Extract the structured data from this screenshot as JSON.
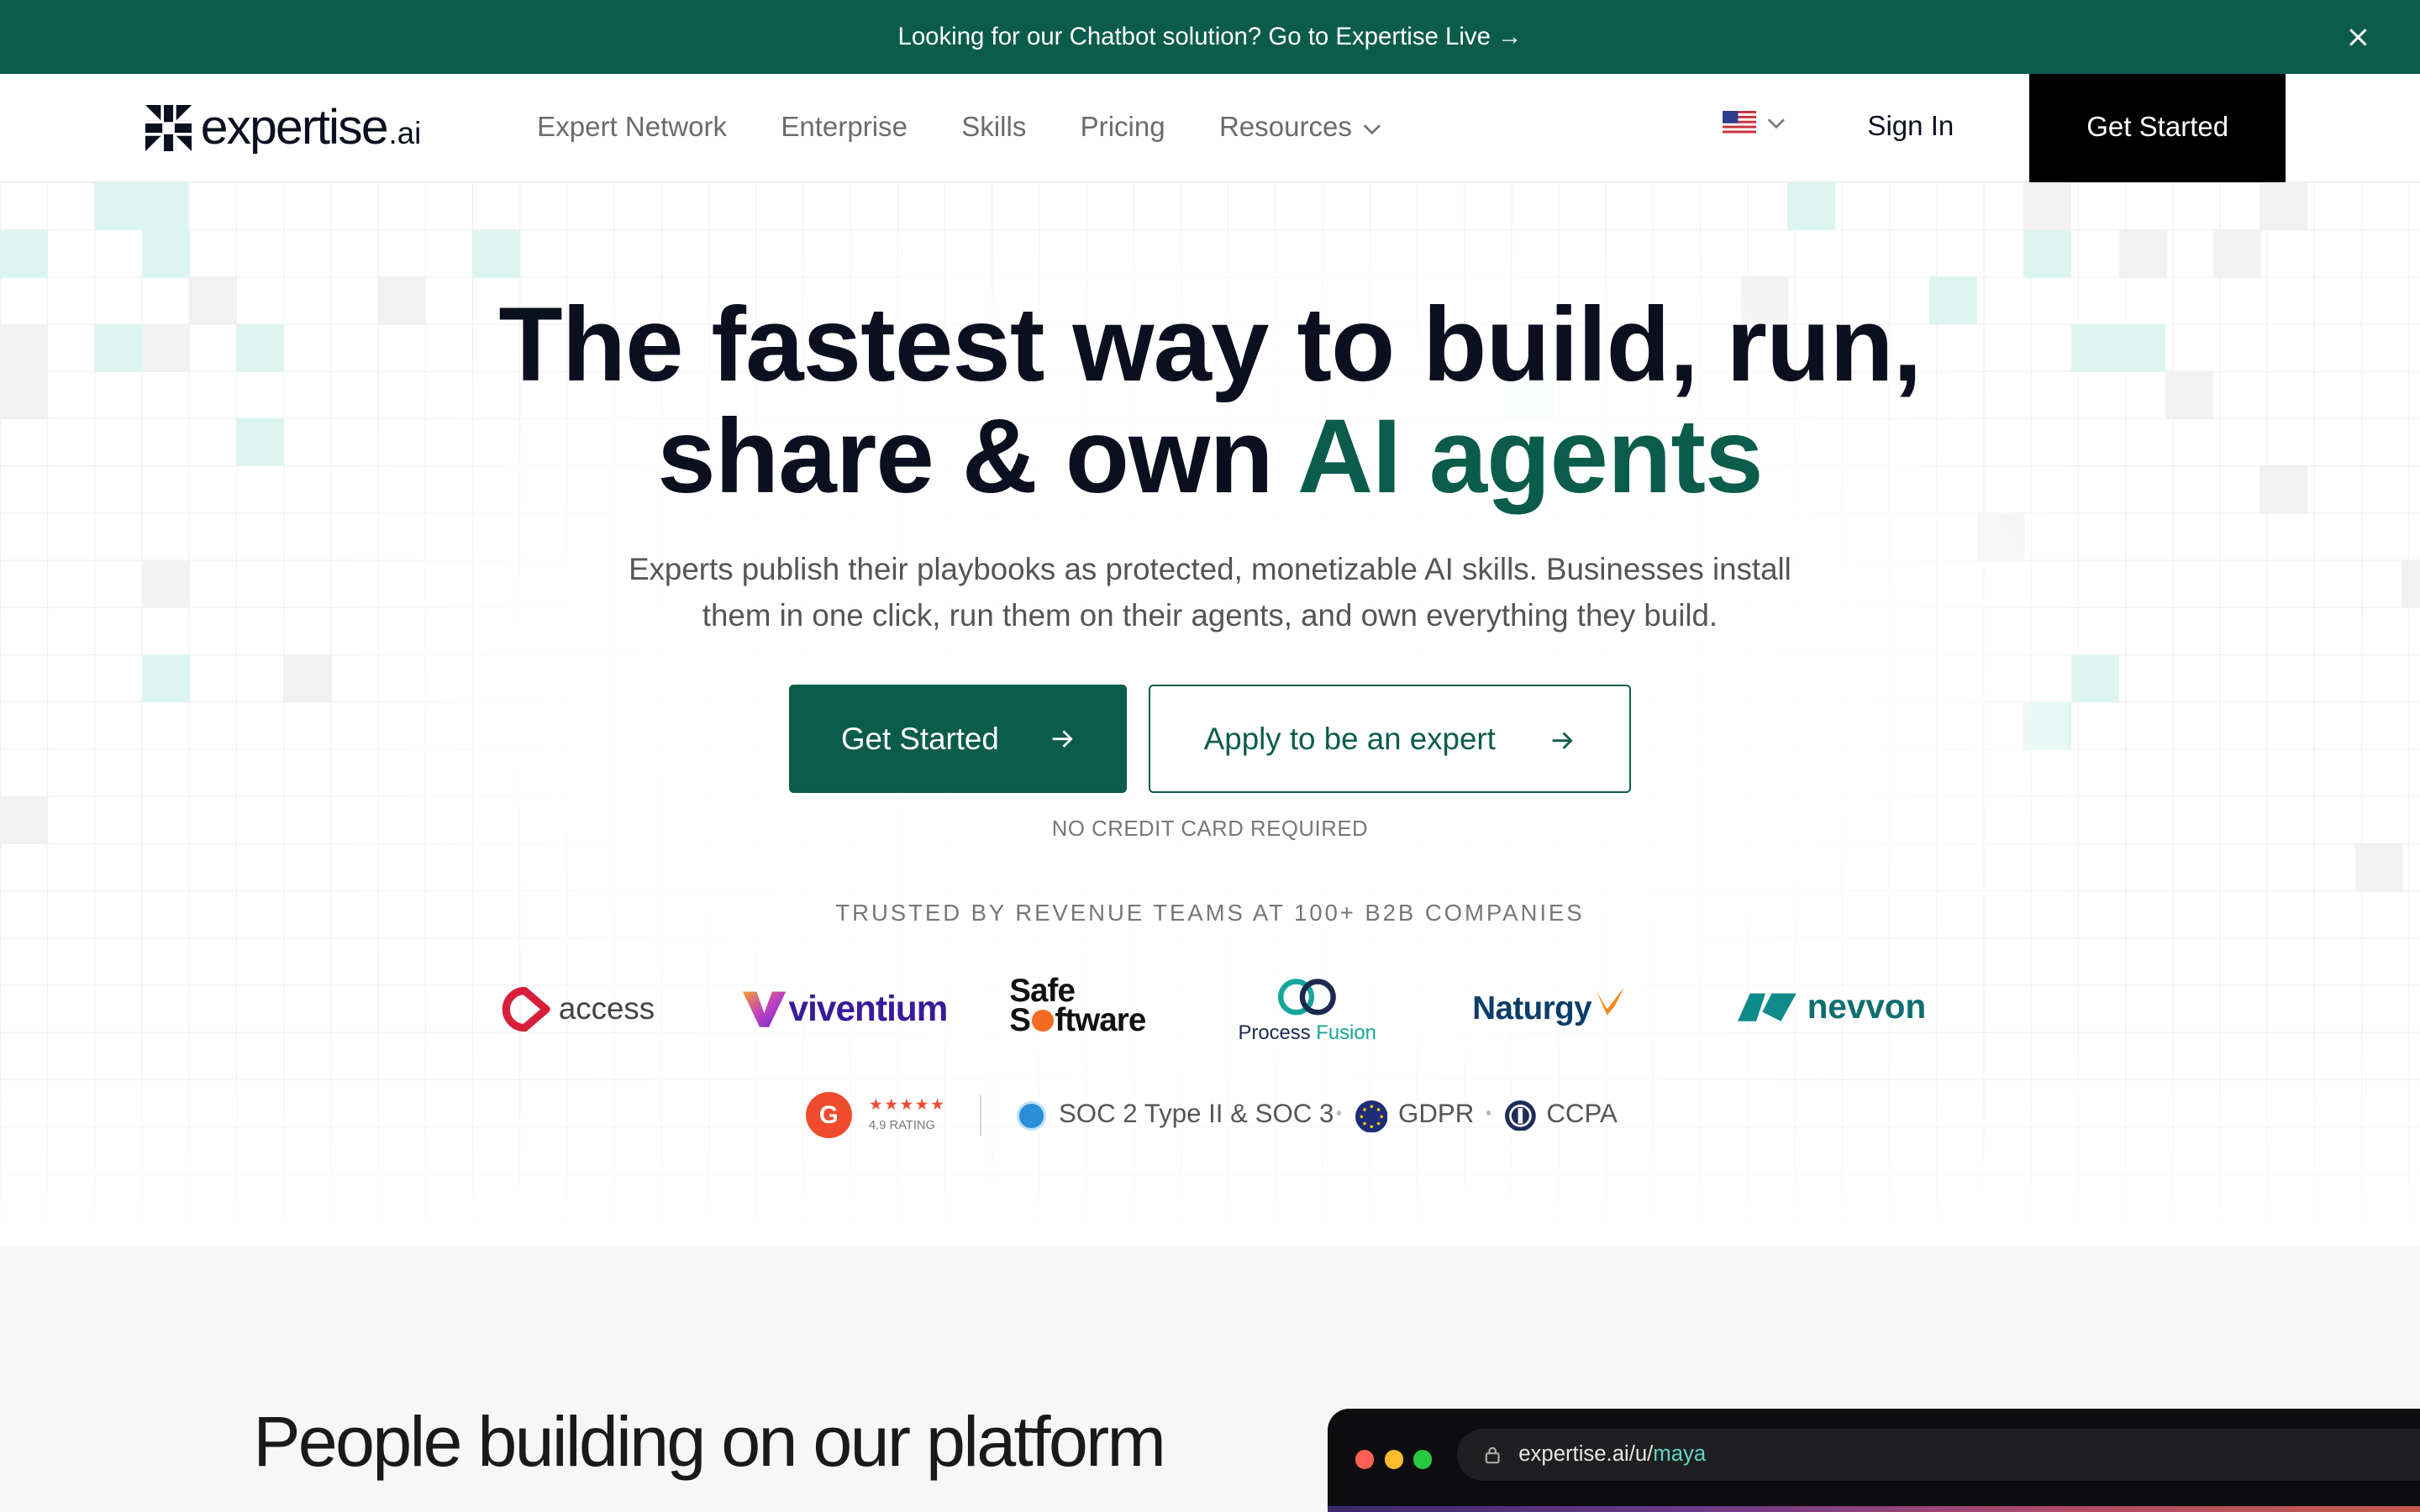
{
  "banner": {
    "text": "Looking for our Chatbot solution? Go to Expertise Live →"
  },
  "nav": {
    "logo_word": "expertise",
    "logo_tld": ".ai",
    "links": [
      "Expert Network",
      "Enterprise",
      "Skills",
      "Pricing",
      "Resources"
    ],
    "sign_in": "Sign In",
    "get_started": "Get Started"
  },
  "hero": {
    "headline_line1": "The fastest way to build, run,",
    "headline_line2_plain": "share & own ",
    "headline_line2_accent": "AI agents",
    "subtitle_line1": "Experts publish their playbooks as protected, monetizable AI skills. Businesses install",
    "subtitle_line2": "them in one click, run them on their agents, and own everything they build.",
    "primary_button": "Get Started",
    "secondary_button": "Apply to be an expert",
    "no_card": "NO CREDIT CARD REQUIRED",
    "trusted": "TRUSTED BY REVENUE TEAMS AT 100+ B2B COMPANIES"
  },
  "logos": {
    "access": "access",
    "viventium": "viventium",
    "safe_line1": "Safe",
    "safe_line2_a": "S",
    "safe_line2_b": "ftware",
    "process": "Process",
    "fusion": "Fusion",
    "naturgy": "Naturgy",
    "nevvon": "nevvon"
  },
  "badges": {
    "rating_stars": "★★★★★",
    "rating_text": "4.9 RATING",
    "g2": "G",
    "soc": "SOC 2 Type II & SOC 3",
    "gdpr": "GDPR",
    "ccpa": "CCPA"
  },
  "section2": {
    "heading": "People building on our platform",
    "url_prefix": "expertise.ai/u/",
    "url_slug": "maya"
  },
  "colors": {
    "brand": "#0c5c4c",
    "accent_mint": "#dff6f1",
    "black": "#000000"
  }
}
